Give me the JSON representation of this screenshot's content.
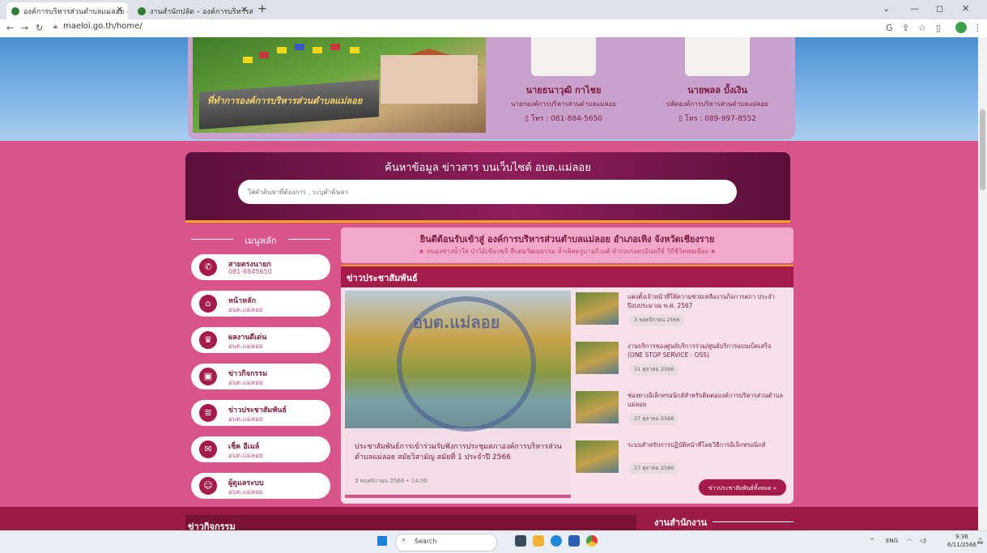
{
  "browser": {
    "tabs": [
      {
        "label": "องค์การบริหารส่วนตำบลแม่ลอย – M"
      },
      {
        "label": "งานสำนักปลัด – องค์การบริหารส่วนต์"
      }
    ],
    "url": "maeloi.go.th/home/"
  },
  "officials": [
    {
      "name": "นายธนาวุฒิ กาไชย",
      "position": "นายกองค์การบริหารส่วนตำบลแม่ลอย",
      "phone": "โทร : 081-884-5650"
    },
    {
      "name": "นายพลล บั้งเงิน",
      "position": "ปลัดองค์การบริหารส่วนตำบลแม่ลอย",
      "phone": "โทร : 089-997-8552"
    }
  ],
  "hero": {
    "sign_text": "ที่ทำการองค์การบริหารส่วนตำบลแม่ลอย"
  },
  "search": {
    "title": "ค้นหาข้อมูล ข่าวสาร บนเว็บไซต์ อบต.แม่ลอย",
    "placeholder": "ใส่คำค้นหาที่ต้องการ , ระบุคำค้นหา"
  },
  "menu": {
    "heading": "เมนูหลัก",
    "items": [
      {
        "title": "สายตรงนายก",
        "sub": "081-8845650",
        "icon": "phone-icon",
        "glyph": "✆"
      },
      {
        "title": "หน้าหลัก",
        "sub": "อบต.แม่ลอย",
        "icon": "home-icon",
        "glyph": "⌂"
      },
      {
        "title": "ผลงานดีเด่น",
        "sub": "อบต.แม่ลอย",
        "icon": "trophy-icon",
        "glyph": "♛"
      },
      {
        "title": "ข่าวกิจกรรม",
        "sub": "อบต.แม่ลอย",
        "icon": "image-icon",
        "glyph": "▣"
      },
      {
        "title": "ข่าวประชาสัมพันธ์",
        "sub": "อบต.แม่ลอย",
        "icon": "document-icon",
        "glyph": "≣"
      },
      {
        "title": "เช็ค อีเมล์",
        "sub": "อบต.แม่ลอย",
        "icon": "mail-icon",
        "glyph": "✉"
      },
      {
        "title": "ผู้ดูแลระบบ",
        "sub": "อบต.แม่ลอย",
        "icon": "user-icon",
        "glyph": "☺"
      }
    ]
  },
  "welcome": {
    "line1": "ยินดีต้อนรับเข้าสู่ องค์การบริหารส่วนตำบลแม่ลอย อำเภอเทิง จังหวัดเชียงราย",
    "line2": "หนองช่างน้ำใส ป่าไม้เขียวขจี สืบต่อวัฒนธรรม ล้ำเลิศครูบาอภิวงศ์ ดำรงเกษตรอินทรีย์ วิถีชีวิตพอเพียง"
  },
  "news": {
    "heading": "ข่าวประชาสัมพันธ์",
    "featured": {
      "seal_text": "อบต.แม่ลอย",
      "title": "ประชาสัมพันธ์การเข้าร่วมรับฟังการประชุมสภาองค์การบริหารส่วนตำบลแม่ลอย สมัยวิสามัญ สมัยที่ 1 ประจำปี 2566",
      "date": "3 พฤศจิกายน 2566 • 14:00"
    },
    "items": [
      {
        "title": "แต่งตั้งเจ้าหน้าที่ให้ความช่วยเหลืองานกิจการสภา ประจำปีงบประมาณ พ.ศ. 2567",
        "date": "3 พฤศจิกายน 2566"
      },
      {
        "title": "งานบริการของศูนย์บริการร่วม/ศูนย์บริการแบบเบ็ดเสร็จ (ONE STOP SERVICE : OSS)",
        "date": "31 ตุลาคม 2566"
      },
      {
        "title": "ช่องทางอิเล็กทรอนิกส์สำหรับติดต่อองค์การบริหารส่วนตำบลแม่ลอย",
        "date": "27 ตุลาคม 2566"
      },
      {
        "title": "ระบบสำหรับการปฏิบัติหน้าที่โดยวิธีการอิเล็กทรอนิกส์",
        "date": "27 ตุลาคม 2566"
      }
    ],
    "all_label": "ข่าวประชาสัมพันธ์ทั้งหมด »"
  },
  "sections": {
    "activities": "ข่าวกิจกรรม",
    "office": "งานสำนักงาน"
  },
  "taskbar": {
    "search": "Search",
    "lang": "ENG",
    "time": "9:36",
    "date": "6/11/2566"
  },
  "colors": {
    "primary": "#a51b4b",
    "page_bg": "#d9548a",
    "accent": "#f4a21a"
  }
}
